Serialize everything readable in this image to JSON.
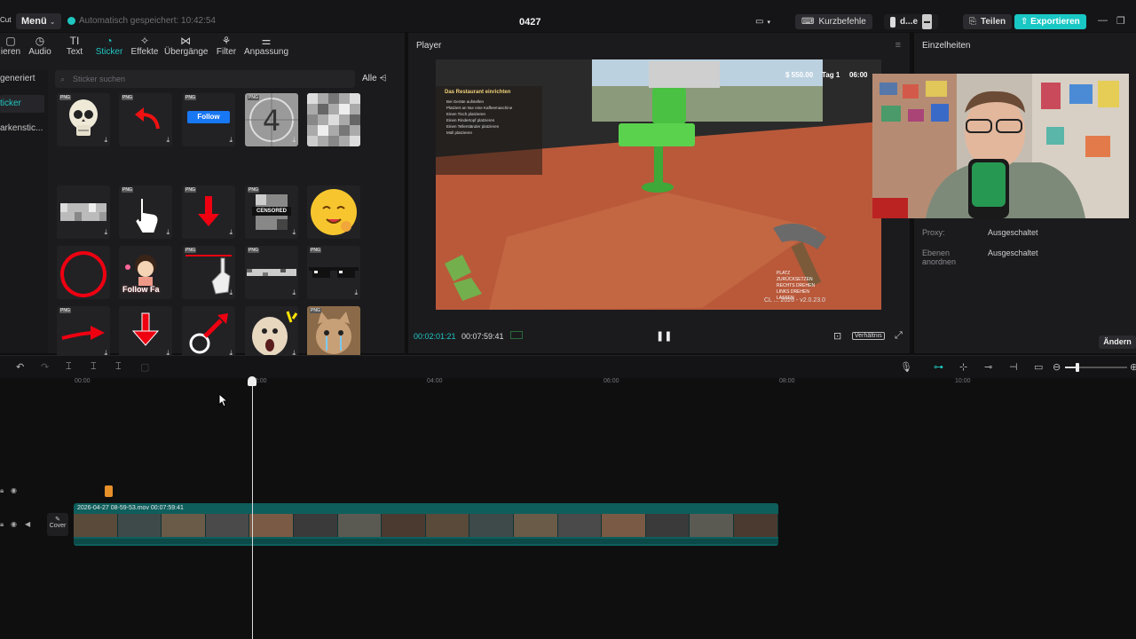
{
  "app": {
    "brand": "Cut",
    "menu_label": "Menü",
    "autosave_text": "Automatisch gespeichert: 10:42:54",
    "project_title": "0427",
    "shortcuts_label": "Kurzbefehle",
    "user_label": "d...e",
    "share_label": "Teilen",
    "export_label": "Exportieren"
  },
  "tabs": [
    {
      "label": "ieren",
      "icon": "import-icon"
    },
    {
      "label": "Audio",
      "icon": "audio-icon"
    },
    {
      "label": "Text",
      "icon": "text-icon"
    },
    {
      "label": "Sticker",
      "icon": "sticker-icon",
      "active": true
    },
    {
      "label": "Effekte",
      "icon": "effects-icon"
    },
    {
      "label": "Übergänge",
      "icon": "transitions-icon"
    },
    {
      "label": "Filter",
      "icon": "filter-icon"
    },
    {
      "label": "Anpassung",
      "icon": "adjust-icon"
    }
  ],
  "categories": [
    {
      "label": "generiert"
    },
    {
      "label": "ticker",
      "active": true
    },
    {
      "label": "arkenstic..."
    }
  ],
  "search": {
    "placeholder": "Sticker suchen",
    "filter_label": "Alle"
  },
  "stickers": [
    {
      "name": "skull-sticker"
    },
    {
      "name": "red-curved-arrow-sticker"
    },
    {
      "name": "follow-button-sticker",
      "text": "Follow"
    },
    {
      "name": "countdown-4-sticker",
      "text": "4"
    },
    {
      "name": "pixel-censor-sticker"
    },
    {
      "name": "blur-bar-sticker"
    },
    {
      "name": "hand-cursor-sticker"
    },
    {
      "name": "red-down-arrow-sticker"
    },
    {
      "name": "censored-sticker",
      "text": "CENSORED"
    },
    {
      "name": "emoji-yum-sticker"
    },
    {
      "name": "red-circle-sticker"
    },
    {
      "name": "girl-follow-sticker",
      "text": "Follow Fa"
    },
    {
      "name": "pointing-finger-sticker"
    },
    {
      "name": "pixel-bar-sticker"
    },
    {
      "name": "pixel-sunglasses-sticker"
    },
    {
      "name": "red-right-arrow-sticker"
    },
    {
      "name": "red-down-arrow2-sticker"
    },
    {
      "name": "circle-arrow-sticker"
    },
    {
      "name": "surprised-dog-sticker"
    },
    {
      "name": "crying-cat-sticker"
    }
  ],
  "player": {
    "title": "Player",
    "current_time": "00:02:01:21",
    "total_time": "00:07:59:41",
    "ratio_label": "Verhältnis",
    "game": {
      "quest_title": "Das Restaurant einrichten",
      "quest_items": [
        "Bei Geräte aufstellen",
        "Platziert an Nur eine Kaffeemaschine",
        "Einen Tisch platzieren",
        "Einen Rindertopf platzieren",
        "Einen Tellerständer platzieren",
        "Müll platzieren"
      ],
      "money": "$ 550.00",
      "day": "Tag 1",
      "clock": "06:00",
      "controls": [
        "PLATZ",
        "ZURÜCKSETZEN",
        "RECHTS DREHEN",
        "LINKS DREHEN",
        "LASSEN"
      ],
      "version": "CL ... 2026 - v2.0.23.0"
    }
  },
  "details": {
    "title": "Einzelheiten",
    "rows": [
      {
        "label": "Proxy:",
        "value": "Ausgeschaltet"
      },
      {
        "label": "Ebenen anordnen",
        "value": "Ausgeschaltet"
      }
    ],
    "change_label": "Ändern"
  },
  "timeline": {
    "ticks": [
      "00:00",
      "02:00",
      "04:00",
      "06:00",
      "08:00",
      "10:00"
    ],
    "clip_label": "2026-04-27 08-59-53.mov  00:07:59:41",
    "cover_label": "Cover"
  },
  "colors": {
    "accent": "#1fc6c1",
    "clip": "#0e5e5c",
    "panel": "#1b1b1e"
  }
}
